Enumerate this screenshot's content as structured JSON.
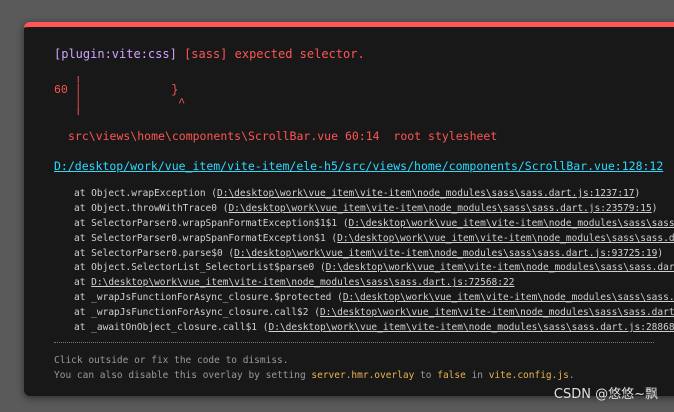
{
  "error": {
    "plugin": "[plugin:vite:css]",
    "message": "[sass] expected selector."
  },
  "frame": {
    "lines": [
      "   ╷",
      "60 │             }",
      "   │              ^",
      "   ╵"
    ],
    "file": "src\\views\\home\\components\\ScrollBar.vue 60:14  root stylesheet"
  },
  "location_link": "D:/desktop/work/vue_item/vite-item/ele-h5/src/views/home/components/ScrollBar.vue:128:12",
  "stack": [
    {
      "text": "at Object.wrapException (",
      "loc": "D:\\desktop\\work\\vue_item\\vite-item\\node_modules\\sass\\sass.dart.js:1237:17",
      "end": ")"
    },
    {
      "text": "at Object.throwWithTrace0 (",
      "loc": "D:\\desktop\\work\\vue_item\\vite-item\\node_modules\\sass\\sass.dart.js:23579:15",
      "end": ")"
    },
    {
      "text": "at SelectorParser0.wrapSpanFormatException$1$1 (",
      "loc": "D:\\desktop\\work\\vue_item\\vite-item\\node_modules\\sass\\sass.da",
      "end": ""
    },
    {
      "text": "at SelectorParser0.wrapSpanFormatException$1 (",
      "loc": "D:\\desktop\\work\\vue_item\\vite-item\\node_modules\\sass\\sass.dart",
      "end": ""
    },
    {
      "text": "at SelectorParser0.parse$0 (",
      "loc": "D:\\desktop\\work\\vue_item\\vite-item\\node_modules\\sass\\sass.dart.js:93725:19",
      "end": ")"
    },
    {
      "text": "at Object.SelectorList_SelectorList$parse0 (",
      "loc": "D:\\desktop\\work\\vue_item\\vite-item\\node_modules\\sass\\sass.dart.j",
      "end": ""
    },
    {
      "text": "at ",
      "loc": "D:\\desktop\\work\\vue_item\\vite-item\\node_modules\\sass\\sass.dart.js:72568:22",
      "end": ""
    },
    {
      "text": "at _wrapJsFunctionForAsync_closure.$protected (",
      "loc": "D:\\desktop\\work\\vue_item\\vite-item\\node_modules\\sass\\sass.dar",
      "end": ""
    },
    {
      "text": "at _wrapJsFunctionForAsync_closure.call$2 (",
      "loc": "D:\\desktop\\work\\vue_item\\vite-item\\node_modules\\sass\\sass.dart.js",
      "end": ""
    },
    {
      "text": "at _awaitOnObject_closure.call$1 (",
      "loc": "D:\\desktop\\work\\vue_item\\vite-item\\node_modules\\sass\\sass.dart.js:28868:32",
      "end": ""
    }
  ],
  "tips": {
    "line1": "Click outside or fix the code to dismiss.",
    "line2_a": "You can also disable this overlay by setting ",
    "line2_code1": "server.hmr.overlay",
    "line2_b": " to ",
    "line2_code2": "false",
    "line2_c": " in ",
    "line2_code3": "vite.config.js",
    "line2_d": "."
  },
  "watermark": "CSDN @悠悠~飘",
  "colors": {
    "error": "#ff5555",
    "plugin": "#cfa4ff",
    "link": "#2dd9fe",
    "code": "#e8b34e",
    "background": "#181818"
  }
}
